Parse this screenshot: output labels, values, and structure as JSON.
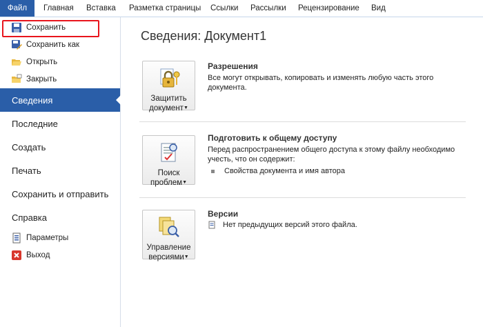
{
  "ribbon": {
    "tabs": [
      "Файл",
      "Главная",
      "Вставка",
      "Разметка страницы",
      "Ссылки",
      "Рассылки",
      "Рецензирование",
      "Вид"
    ]
  },
  "backstage": {
    "commands": [
      {
        "label": "Сохранить",
        "icon": "save-icon"
      },
      {
        "label": "Сохранить как",
        "icon": "save-as-icon"
      },
      {
        "label": "Открыть",
        "icon": "open-folder-icon"
      },
      {
        "label": "Закрыть",
        "icon": "close-folder-icon"
      }
    ],
    "tabs": [
      "Сведения",
      "Последние",
      "Создать",
      "Печать",
      "Сохранить и отправить",
      "Справка"
    ],
    "active_tab": "Сведения",
    "bottom": [
      {
        "label": "Параметры",
        "icon": "options-icon"
      },
      {
        "label": "Выход",
        "icon": "exit-icon"
      }
    ]
  },
  "info": {
    "title": "Сведения: Документ1",
    "permissions": {
      "button_line1": "Защитить",
      "button_line2": "документ",
      "heading": "Разрешения",
      "text": "Все могут открывать, копировать и изменять любую часть этого документа."
    },
    "prepare": {
      "button_line1": "Поиск",
      "button_line2": "проблем",
      "heading": "Подготовить к общему доступу",
      "text": "Перед распространением общего доступа к этому файлу необходимо учесть, что он содержит:",
      "bullet": "Свойства документа и имя автора"
    },
    "versions": {
      "button_line1": "Управление",
      "button_line2": "версиями",
      "heading": "Версии",
      "text": "Нет предыдущих версий этого файла."
    }
  },
  "colors": {
    "file_tab": "#2a5ea8",
    "active_item": "#2a5ea8",
    "highlight_box": "#e8141c"
  }
}
